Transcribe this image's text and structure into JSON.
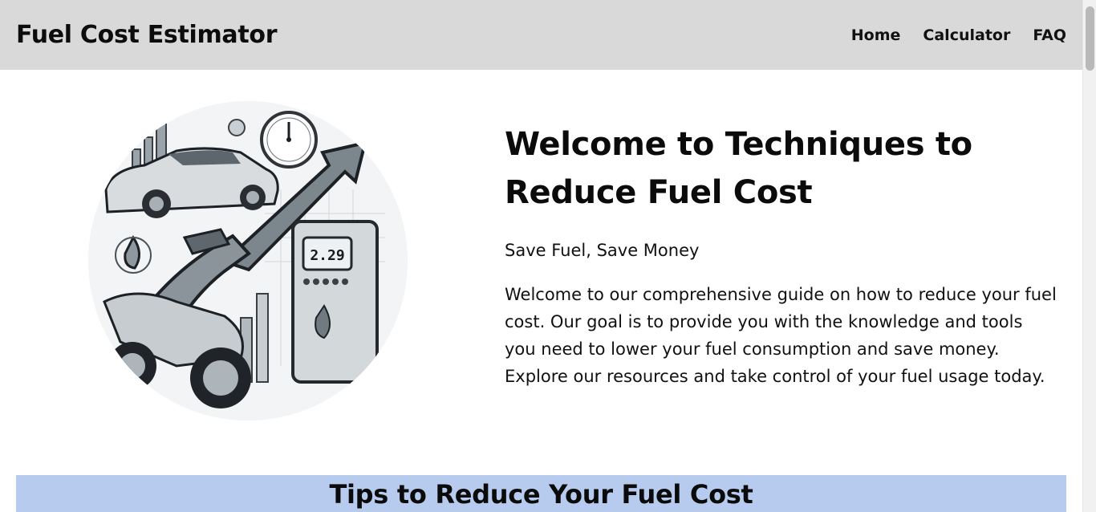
{
  "header": {
    "brand": "Fuel Cost Estimator",
    "nav": [
      {
        "label": "Home"
      },
      {
        "label": "Calculator"
      },
      {
        "label": "FAQ"
      }
    ]
  },
  "hero": {
    "title": "Welcome to Techniques to Reduce Fuel Cost",
    "subtitle": "Save Fuel, Save Money",
    "description": "Welcome to our comprehensive guide on how to reduce your fuel cost. Our goal is to provide you with the knowledge and tools you need to lower your fuel consumption and save money. Explore our resources and take control of your fuel usage today.",
    "image": {
      "pump_display": "2.29"
    }
  },
  "tips": {
    "heading": "Tips to Reduce Your Fuel Cost"
  },
  "colors": {
    "header_bg": "#d9d9d9",
    "tips_bg": "#b7cbee",
    "text": "#0b0b0b"
  }
}
